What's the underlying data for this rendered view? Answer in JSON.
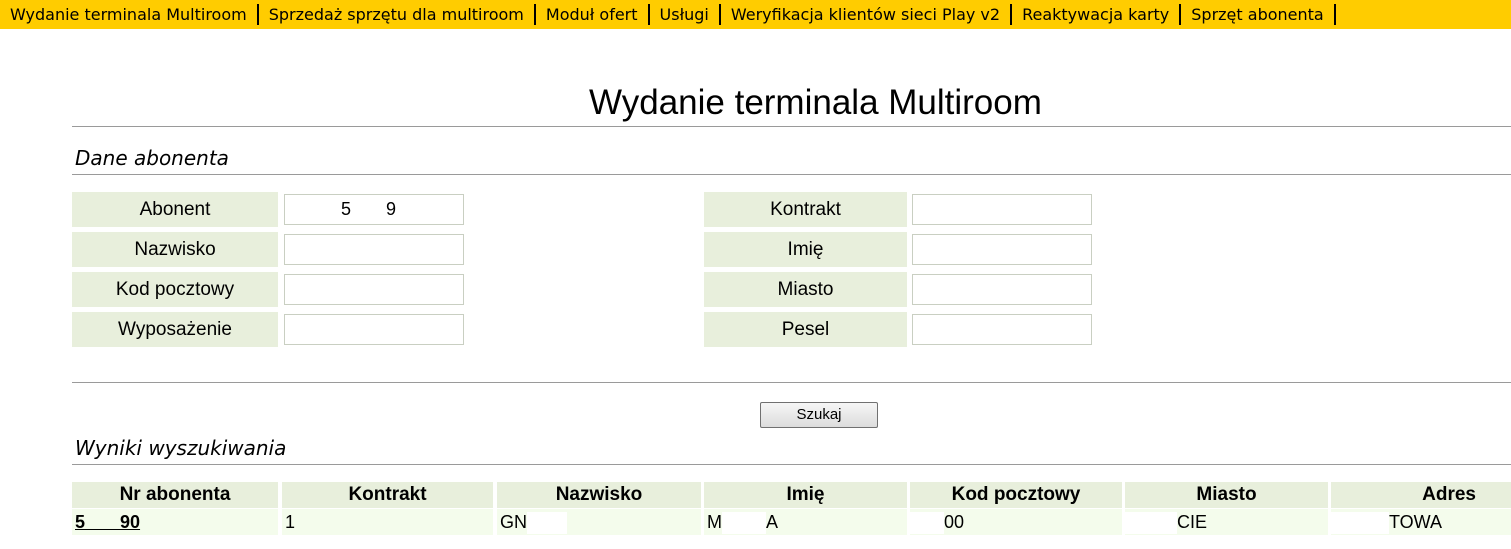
{
  "nav": {
    "items": [
      "Wydanie terminala Multiroom",
      "Sprzedaż sprzętu dla multiroom",
      "Moduł ofert",
      "Usługi",
      "Weryfikacja klientów sieci Play v2",
      "Reaktywacja karty",
      "Sprzęt abonenta"
    ]
  },
  "page": {
    "title": "Wydanie terminala Multiroom"
  },
  "form": {
    "section_title": "Dane abonenta",
    "left": [
      {
        "label": "Abonent",
        "value": "5       9"
      },
      {
        "label": "Nazwisko",
        "value": ""
      },
      {
        "label": "Kod pocztowy",
        "value": ""
      },
      {
        "label": "Wyposażenie",
        "value": ""
      }
    ],
    "right": [
      {
        "label": "Kontrakt",
        "value": ""
      },
      {
        "label": "Imię",
        "value": ""
      },
      {
        "label": "Miasto",
        "value": ""
      },
      {
        "label": "Pesel",
        "value": ""
      }
    ],
    "search_button": "Szukaj"
  },
  "results": {
    "section_title": "Wyniki wyszukiwania",
    "columns": [
      "Nr abonenta",
      "Kontrakt",
      "Nazwisko",
      "Imię",
      "Kod pocztowy",
      "Miasto",
      "Adres"
    ],
    "rows": [
      {
        "nr_abonenta": "5       90",
        "kontrakt": "1",
        "nazwisko": "GN",
        "imie_a": "M",
        "imie_b": "A",
        "kod_pocztowy": "00",
        "miasto": "CIE",
        "adres": "TOWA"
      }
    ]
  },
  "colors": {
    "nav_bg": "#ffcc00",
    "label_bg": "#e8efdc",
    "row_bg": "#f4fcec"
  }
}
